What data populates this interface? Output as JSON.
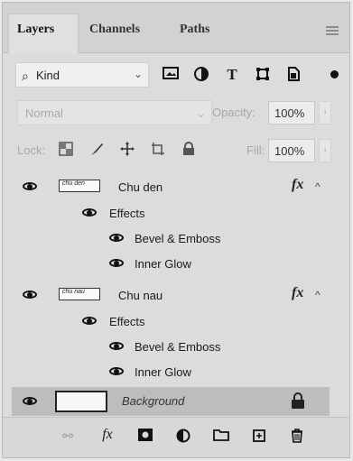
{
  "tabs": [
    {
      "label": "Layers"
    },
    {
      "label": "Channels"
    },
    {
      "label": "Paths"
    }
  ],
  "filter": {
    "kind_label": "Kind",
    "icons": [
      "image-filter-icon",
      "adjustment-filter-icon",
      "type-filter-icon",
      "shape-filter-icon",
      "smart-object-filter-icon"
    ],
    "type_glyph": "T"
  },
  "blend": {
    "mode": "Normal",
    "opacity_label": "Opacity:",
    "opacity_value": "100%"
  },
  "lock": {
    "label": "Lock:",
    "fill_label": "Fill:",
    "fill_value": "100%"
  },
  "layers": [
    {
      "name": "Chu den",
      "thumb_text": "chu den",
      "fx": "fx",
      "effects_label": "Effects",
      "effects": [
        "Bevel & Emboss",
        "Inner Glow"
      ]
    },
    {
      "name": "Chu nau",
      "thumb_text": "chu nau",
      "fx": "fx",
      "effects_label": "Effects",
      "effects": [
        "Bevel & Emboss",
        "Inner Glow"
      ]
    }
  ],
  "background_layer": {
    "name": "Background"
  },
  "bottom_toolbar": {
    "fx_label": "fx",
    "icons": [
      "link-icon",
      "fx-icon",
      "mask-icon",
      "adjustment-icon",
      "folder-icon",
      "new-layer-icon",
      "trash-icon"
    ]
  }
}
